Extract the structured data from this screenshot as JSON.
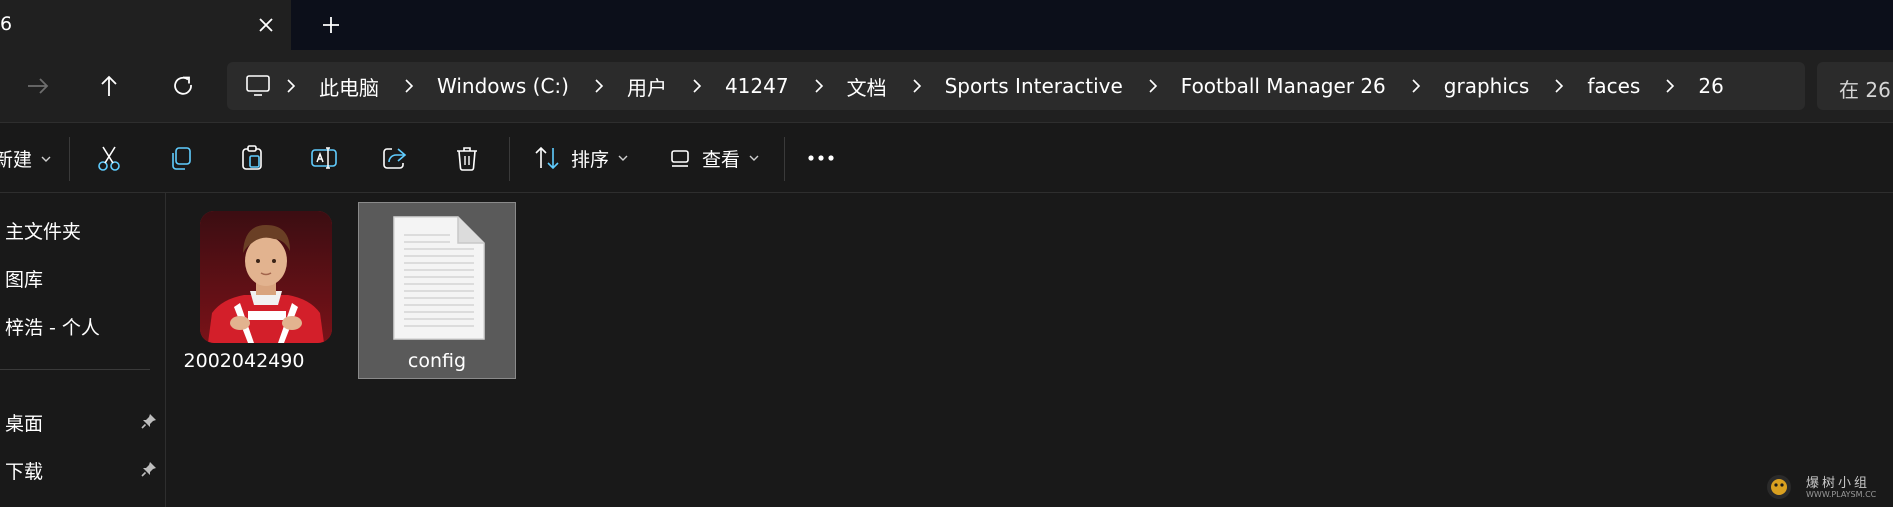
{
  "tab": {
    "title": "6"
  },
  "breadcrumb": [
    {
      "label": "此电脑"
    },
    {
      "label": "Windows (C:)"
    },
    {
      "label": "用户"
    },
    {
      "label": "41247"
    },
    {
      "label": "文档"
    },
    {
      "label": "Sports Interactive"
    },
    {
      "label": "Football Manager 26"
    },
    {
      "label": "graphics"
    },
    {
      "label": "faces"
    },
    {
      "label": "26"
    }
  ],
  "search": {
    "text": "在 26"
  },
  "commandbar": {
    "new_label": "新建",
    "sort_label": "排序",
    "view_label": "查看"
  },
  "sidebar": {
    "items": [
      {
        "label": "主文件夹",
        "pinned": false
      },
      {
        "label": "图库",
        "pinned": false
      },
      {
        "label": "梓浩 - 个人",
        "pinned": false
      },
      {
        "label": "桌面",
        "pinned": true
      },
      {
        "label": "下载",
        "pinned": true
      }
    ]
  },
  "files": [
    {
      "name": "2002042490",
      "type": "image",
      "selected": false
    },
    {
      "name": "config",
      "type": "document",
      "selected": true
    }
  ],
  "watermark": {
    "text": "爆树小组",
    "sub": "WWW.PLAYSM.CC"
  },
  "colors": {
    "window_bg": "#191919",
    "bar_bg": "#202020",
    "field_bg": "#2b2b2b",
    "accent_icon": "#60cdff",
    "selected_bg": "#5a5a5a"
  }
}
